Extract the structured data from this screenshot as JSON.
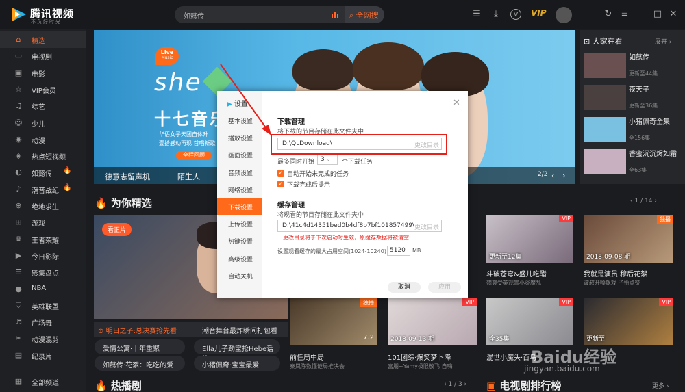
{
  "header": {
    "brand": "腾讯视频",
    "slogan": "不负好时光",
    "search_query": "如懿传",
    "search_all": "全网搜",
    "vip": "VIP"
  },
  "sidebar": {
    "items": [
      {
        "label": "精选",
        "icon": "home-icon",
        "active": true
      },
      {
        "label": "电视剧",
        "icon": "tv-icon"
      },
      {
        "label": "电影",
        "icon": "film-icon"
      },
      {
        "label": "VIP会员",
        "icon": "star-icon"
      },
      {
        "label": "综艺",
        "icon": "mic-icon"
      },
      {
        "label": "少儿",
        "icon": "kid-icon"
      },
      {
        "label": "动漫",
        "icon": "anime-icon"
      },
      {
        "label": "热点短视频",
        "icon": "hot-icon"
      },
      {
        "label": "如懿传",
        "icon": "drama-icon",
        "hot": true
      },
      {
        "label": "潮音战纪",
        "icon": "music-icon",
        "hot": true
      },
      {
        "label": "绝地求生",
        "icon": "game-icon"
      },
      {
        "label": "游戏",
        "icon": "gamepad-icon"
      },
      {
        "label": "王者荣耀",
        "icon": "crown-icon"
      },
      {
        "label": "今日影际",
        "icon": "clap-icon"
      },
      {
        "label": "影集盘点",
        "icon": "list-icon"
      },
      {
        "label": "NBA",
        "icon": "basketball-icon"
      },
      {
        "label": "英雄联盟",
        "icon": "shield-icon"
      },
      {
        "label": "广场舞",
        "icon": "dance-icon"
      },
      {
        "label": "动漫混剪",
        "icon": "scissors-icon"
      },
      {
        "label": "纪录片",
        "icon": "doc-icon"
      }
    ],
    "all_channels": "全部频道"
  },
  "banner": {
    "live_badge": "Live",
    "live_sub": "Music",
    "she": "she",
    "headline": "十七音乐",
    "sub1": "华语女子天团自体升",
    "sub2": "壹拾感动再现 首唱新歌",
    "watch_btn": "全程回顾",
    "caption_left": "德意志留声机",
    "caption_right": "陌生人",
    "pager": "2/2"
  },
  "right_panel": {
    "title": "大家在看",
    "expand": "展开",
    "items": [
      {
        "title": "如懿传",
        "sub": "更新至44集"
      },
      {
        "title": "夜天子",
        "sub": "更新至36集"
      },
      {
        "title": "小猪佩奇全集",
        "sub": "全156集"
      },
      {
        "title": "香蜜沉沉烬如霜",
        "sub": "全63集"
      }
    ]
  },
  "section_picks": {
    "title": "为你精选",
    "pager": "1 / 14",
    "feature_badge": "看正片",
    "feature_caption": "明日之子:总决赛抢先看",
    "pills": [
      "爱情公寓·十年重聚",
      "如懿传·花絮：吃吃的爱",
      "潮音舞台最炸瞬间打包看",
      "Ella儿子劲宝抢Hebe话筒",
      "小猪佩奇·宝宝最爱"
    ],
    "cards": [
      {
        "title": "斗破苍穹&盛儿吃醋",
        "sub": "魏爽受英观置小炎魔乱",
        "ep": "更新至12集",
        "tag": "VIP"
      },
      {
        "title": "我就是演员·穆后花絮",
        "sub": "波叔开嗓飙戏 子怡点赞",
        "ep": "2018-09-08 期",
        "tag": "独播"
      },
      {
        "title": "前任局中局",
        "sub": "秦岚陈数懂谜局推决会",
        "ep": "7.2",
        "tag": "独播"
      },
      {
        "title": "101团综·爆笑梦卜降",
        "sub": "富朋~Yamy极限放飞 自嗨",
        "ep": "2018-09-13 期",
        "tag": "VIP"
      },
      {
        "title": "混世小魔头·百鸟",
        "sub": "",
        "ep": "全35集",
        "tag": "VIP"
      },
      {
        "title": "",
        "sub": "",
        "ep": "更新至",
        "tag": "VIP"
      }
    ]
  },
  "section_hot": {
    "title": "热播剧",
    "pager": "1 / 3"
  },
  "section_rank": {
    "title": "电视剧排行榜",
    "more": "更多"
  },
  "dialog": {
    "title": "设置",
    "nav": [
      "基本设置",
      "播放设置",
      "画面设置",
      "音频设置",
      "网络设置",
      "下载设置",
      "上传设置",
      "热键设置",
      "高级设置",
      "自动关机"
    ],
    "active_nav": "下载设置",
    "download_heading": "下载管理",
    "download_desc": "将下载的节目存储在此文件夹中",
    "download_path": "D:\\QLDownload\\",
    "change_dir": "更改目录",
    "concurrent_label": "最多同时开始",
    "concurrent_value": "3",
    "concurrent_suffix": "个下载任务",
    "auto_start": "自动开始未完成的任务",
    "finish_notice": "下载完成后提示",
    "cache_heading": "缓存管理",
    "cache_desc": "将观看的节目存储在此文件夹中",
    "cache_path": "D:\\41c4d14351bed0b4df8b7bf101857499\\",
    "cache_change": "更改目录",
    "cache_warning": "更改目录将于下次启动时生效，原缓存数据将被清空!",
    "cache_size_label": "设置观看缓存的最大占用空间(1024-10240)",
    "cache_size_value": "5120",
    "cache_size_unit": "MB",
    "cancel": "取消",
    "apply": "应用"
  },
  "watermark": {
    "brand": "Baidu经验",
    "url": "jingyan.baidu.com"
  },
  "colors": {
    "accent": "#ff6a1a",
    "highlight_box": "#e8201a"
  }
}
